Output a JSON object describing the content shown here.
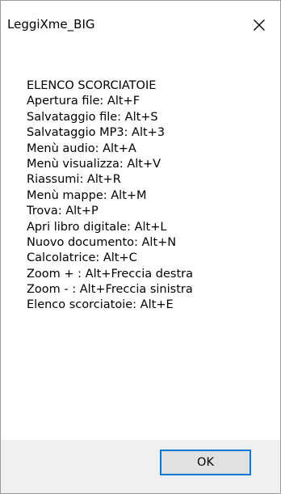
{
  "window": {
    "title": "LeggiXme_BIG",
    "close_icon": "close-icon"
  },
  "content": {
    "lines": [
      "ELENCO SCORCIATOIE",
      "Apertura file:  Alt+F",
      "Salvataggio file: Alt+S",
      "Salvataggio MP3: Alt+3",
      "Menù audio: Alt+A",
      "Menù visualizza: Alt+V",
      "Riassumi: Alt+R",
      "Menù mappe: Alt+M",
      "Trova: Alt+P",
      "Apri libro digitale: Alt+L",
      "Nuovo documento: Alt+N",
      "Calcolatrice: Alt+C",
      "Zoom + : Alt+Freccia destra",
      "Zoom - : Alt+Freccia sinistra",
      "Elenco scorciatoie: Alt+E"
    ]
  },
  "footer": {
    "ok_label": "OK"
  },
  "colors": {
    "focus_border": "#0078d7",
    "dialog_background": "#f0f0f0",
    "content_background": "#ffffff"
  }
}
